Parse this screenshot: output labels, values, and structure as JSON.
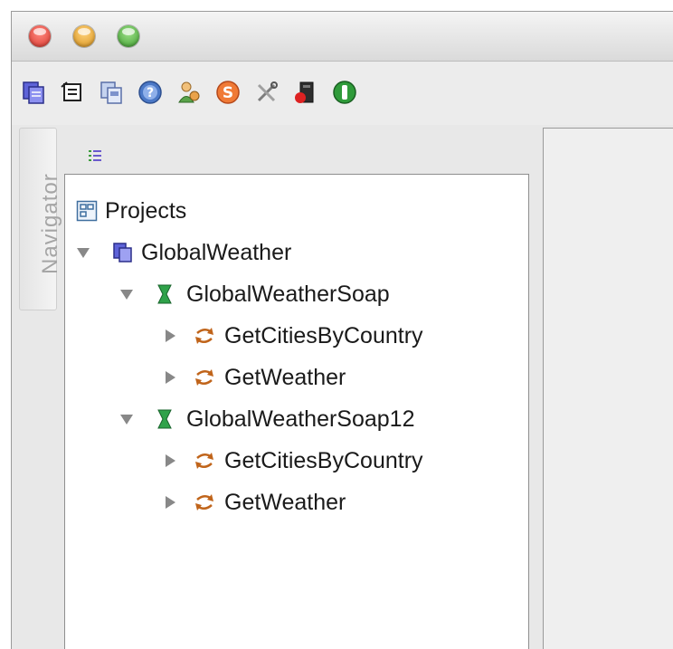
{
  "window": {
    "buttons": [
      {
        "name": "close",
        "color": "#e0443e"
      },
      {
        "name": "minimize",
        "color": "#e5a63a"
      },
      {
        "name": "zoom",
        "color": "#46b33d"
      }
    ]
  },
  "toolbar": {
    "icons": [
      "new-project-icon",
      "import-project-icon",
      "save-all-icon",
      "help-icon",
      "preferences-icon",
      "soapui-online-icon",
      "tools-icon",
      "monitor-icon",
      "jdbc-icon"
    ]
  },
  "navigator": {
    "label": "Navigator"
  },
  "tree": {
    "root": "Projects",
    "project": "GlobalWeather",
    "interfaces": [
      {
        "name": "GlobalWeatherSoap",
        "operations": [
          "GetCitiesByCountry",
          "GetWeather"
        ]
      },
      {
        "name": "GlobalWeatherSoap12",
        "operations": [
          "GetCitiesByCountry",
          "GetWeather"
        ]
      }
    ]
  }
}
